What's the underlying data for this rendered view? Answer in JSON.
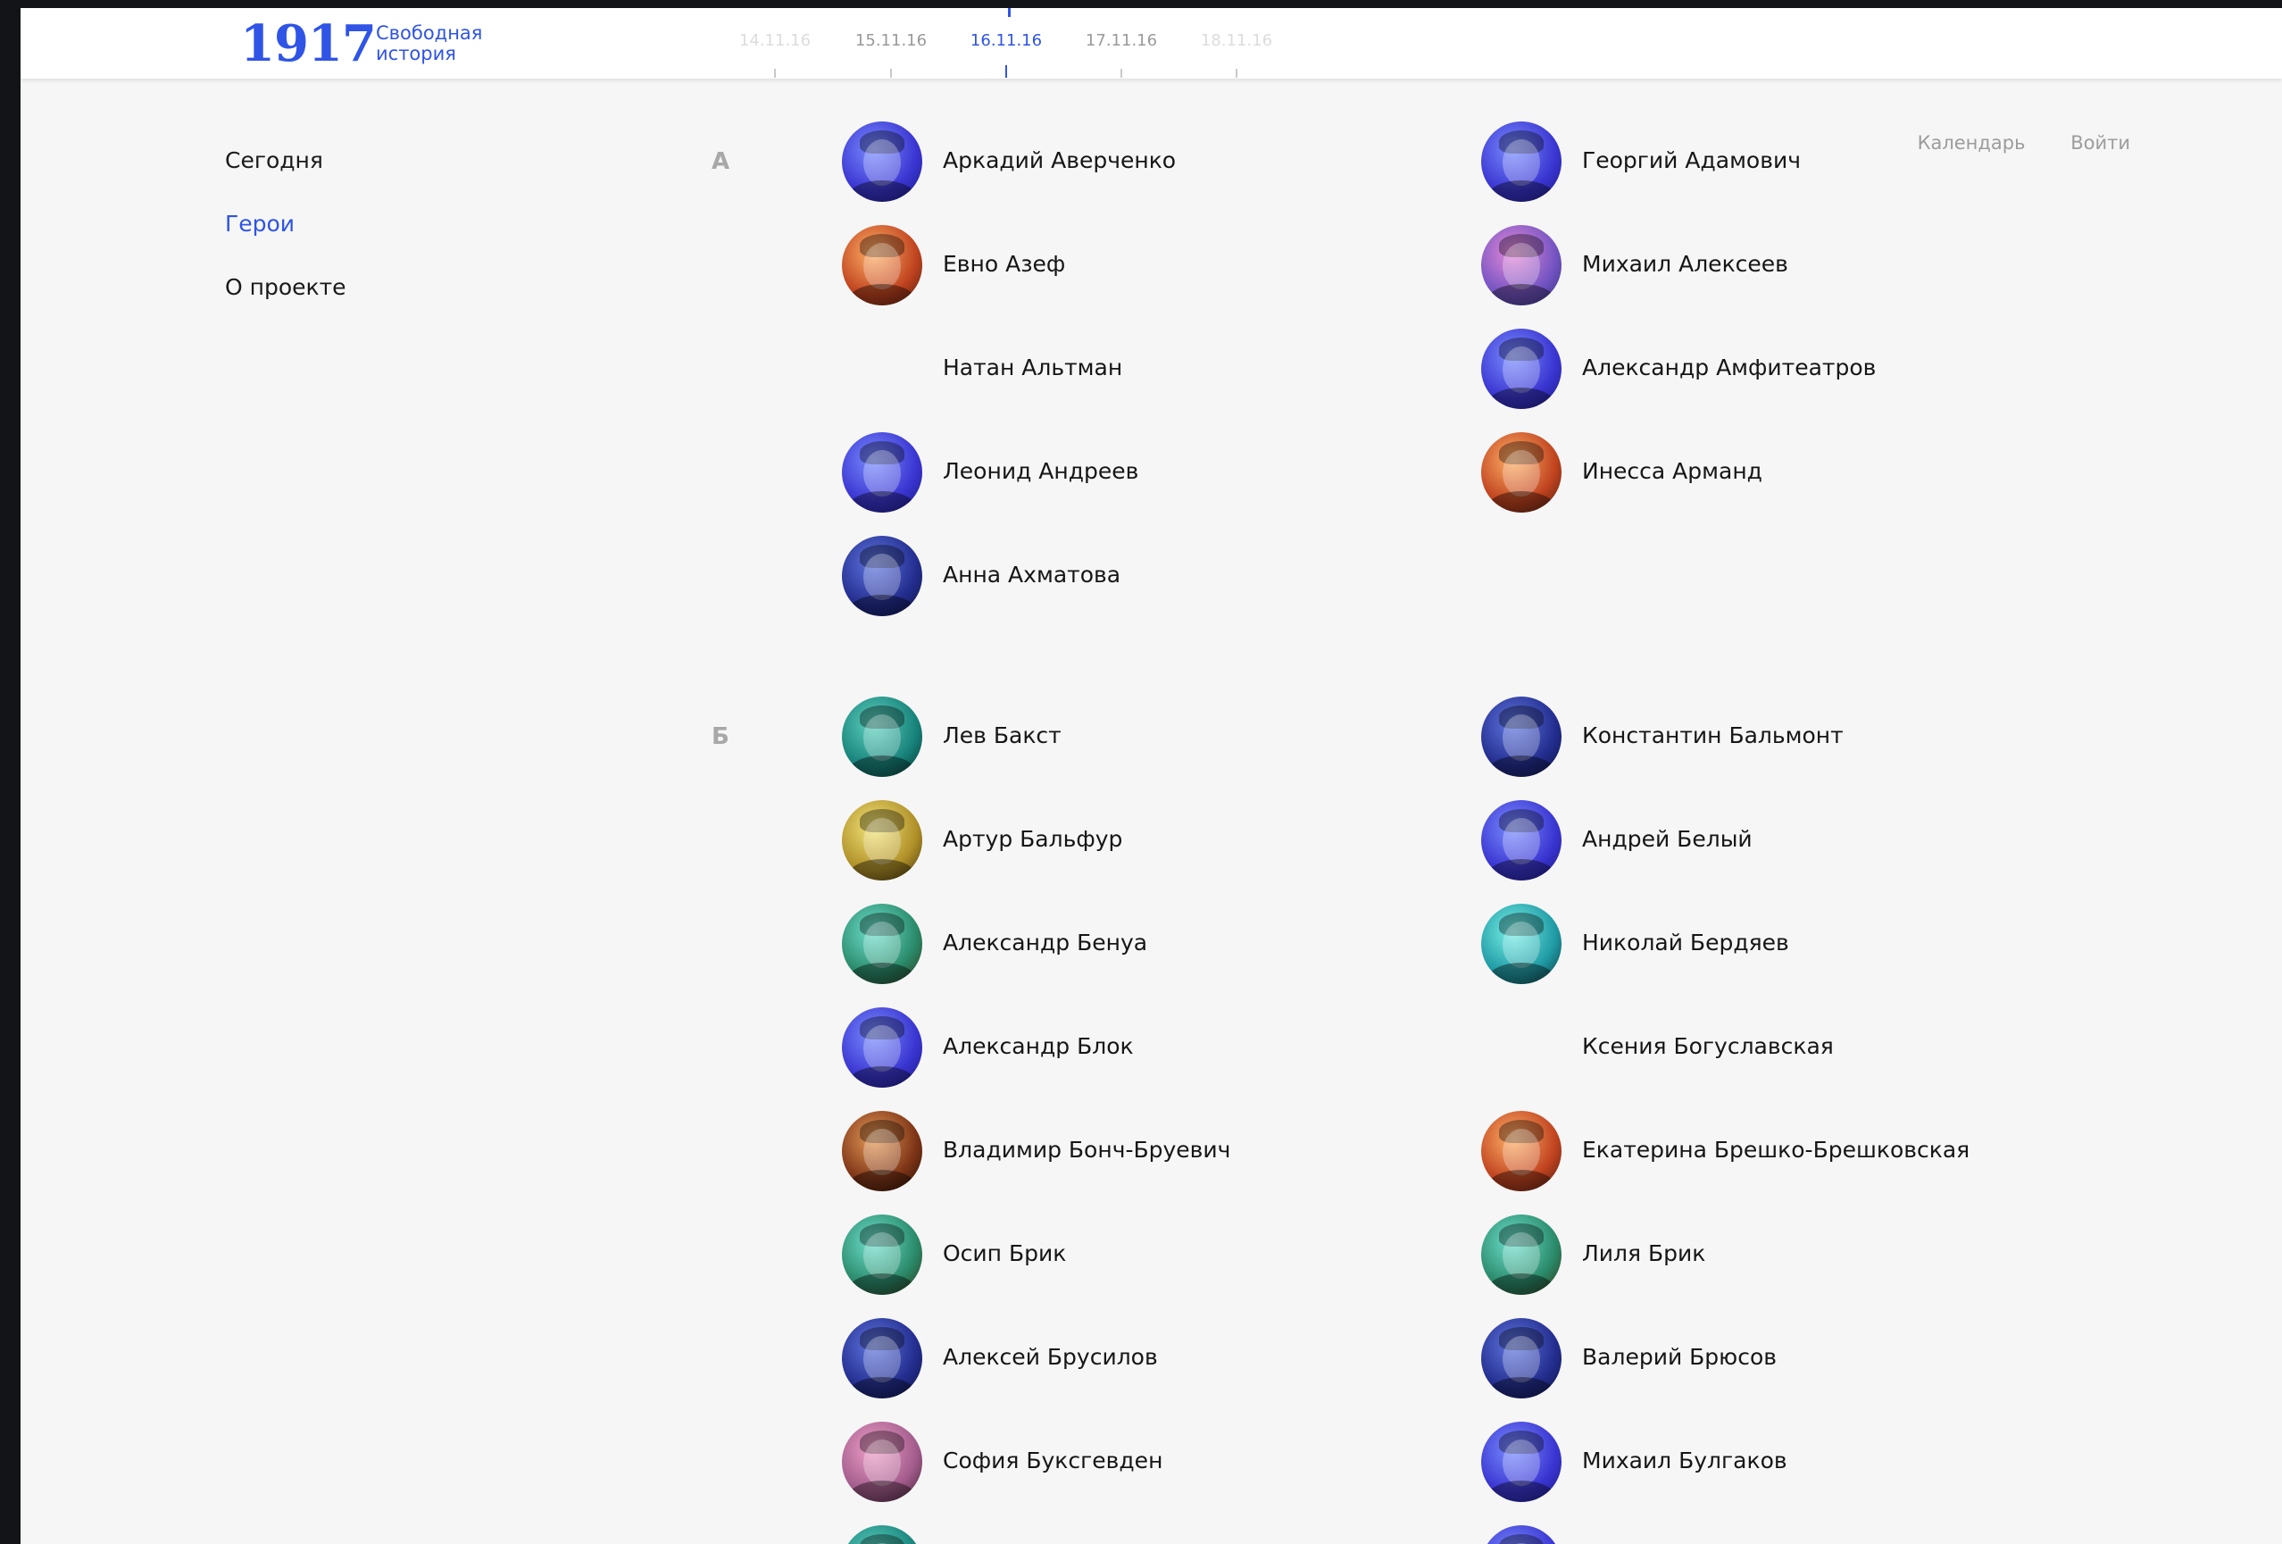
{
  "header": {
    "logo_number": "1917",
    "logo_text_line1": "Свободная",
    "logo_text_line2": "история",
    "dates": [
      "14.11.16",
      "15.11.16",
      "16.11.16",
      "17.11.16",
      "18.11.16"
    ],
    "active_date": "16.11.16"
  },
  "top_links": {
    "calendar": "Календарь",
    "login": "Войти"
  },
  "nav": {
    "items": [
      {
        "label": "Сегодня",
        "active": false
      },
      {
        "label": "Герои",
        "active": true
      },
      {
        "label": "О проекте",
        "active": false
      }
    ]
  },
  "sections": [
    {
      "letter": "А",
      "heroes": [
        {
          "name": "Аркадий Аверченко",
          "avatar": "g-blue"
        },
        {
          "name": "Георгий Адамович",
          "avatar": "g-blue"
        },
        {
          "name": "Евно Азеф",
          "avatar": "g-orange"
        },
        {
          "name": "Михаил Алексеев",
          "avatar": "g-purple"
        },
        {
          "name": "Натан Альтман",
          "avatar": ""
        },
        {
          "name": "Александр Амфитеатров",
          "avatar": "g-blue"
        },
        {
          "name": "Леонид Андреев",
          "avatar": "g-blue"
        },
        {
          "name": "Инесса Арманд",
          "avatar": "g-orange"
        },
        {
          "name": "Анна Ахматова",
          "avatar": "g-dblue"
        }
      ]
    },
    {
      "letter": "Б",
      "heroes": [
        {
          "name": "Лев Бакст",
          "avatar": "g-teal"
        },
        {
          "name": "Константин Бальмонт",
          "avatar": "g-dblue"
        },
        {
          "name": "Артур Бальфур",
          "avatar": "g-yellow"
        },
        {
          "name": "Андрей Белый",
          "avatar": "g-blue"
        },
        {
          "name": "Александр Бенуа",
          "avatar": "g-tealy"
        },
        {
          "name": "Николай Бердяев",
          "avatar": "g-cyan"
        },
        {
          "name": "Александр Блок",
          "avatar": "g-blue"
        },
        {
          "name": "Ксения Богуславская",
          "avatar": ""
        },
        {
          "name": "Владимир Бонч-Бруевич",
          "avatar": "g-brown"
        },
        {
          "name": "Екатерина Брешко-Брешковская",
          "avatar": "g-orange"
        },
        {
          "name": "Осип Брик",
          "avatar": "g-tealy"
        },
        {
          "name": "Лиля Брик",
          "avatar": "g-tealy"
        },
        {
          "name": "Алексей Брусилов",
          "avatar": "g-dblue"
        },
        {
          "name": "Валерий Брюсов",
          "avatar": "g-dblue"
        },
        {
          "name": "София Буксгевден",
          "avatar": "g-pink"
        },
        {
          "name": "Михаил Булгаков",
          "avatar": "g-blue"
        },
        {
          "name": "",
          "avatar": "g-teal"
        },
        {
          "name": "",
          "avatar": "g-blue"
        }
      ]
    }
  ]
}
